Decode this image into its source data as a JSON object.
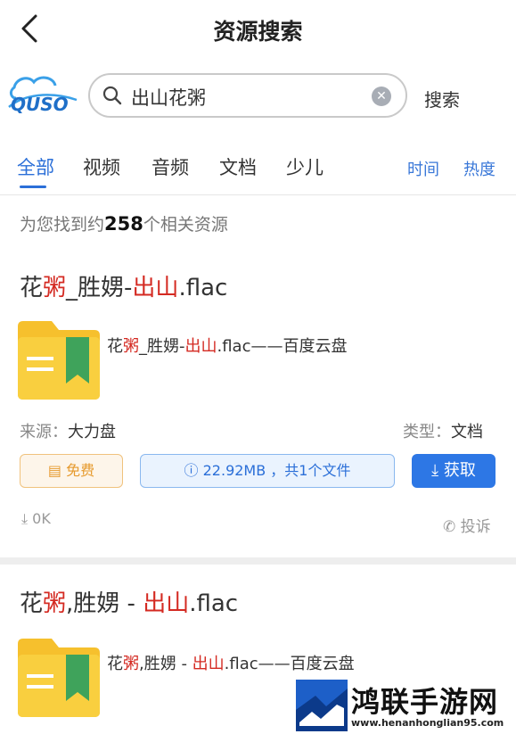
{
  "header": {
    "title": "资源搜索"
  },
  "search": {
    "value": "出山花粥",
    "button": "搜索"
  },
  "logo": {
    "text": "QUSO"
  },
  "tabs": [
    {
      "label": "全部",
      "active": true
    },
    {
      "label": "视频"
    },
    {
      "label": "音频"
    },
    {
      "label": "文档"
    },
    {
      "label": "少儿"
    }
  ],
  "sort": {
    "time": "时间",
    "hot": "热度"
  },
  "result_count": {
    "prefix": "为您找到约",
    "number": "258",
    "suffix": "个相关资源"
  },
  "results": [
    {
      "title_parts": [
        "花",
        "粥",
        "_胜娚-",
        "出山",
        ".flac"
      ],
      "desc_parts": [
        "花",
        "粥",
        "_胜娚-",
        "出山",
        ".flac——百度云盘"
      ],
      "source_label": "来源：",
      "source": "大力盘",
      "type_label": "类型：",
      "type": "文档",
      "free": "免费",
      "size": "22.92MB ，共1个文件",
      "get": "获取",
      "downloads": "0K",
      "report": "投诉"
    },
    {
      "title_parts": [
        "花",
        "粥",
        ",胜娚 - ",
        "出山",
        ".flac"
      ],
      "desc_parts": [
        "花",
        "粥",
        ",胜娚 - ",
        "出山",
        ".flac——百度云盘"
      ]
    }
  ],
  "watermark": {
    "text": "鸿联手游网",
    "url": "www.henanhonglian95.com"
  },
  "colors": {
    "accent": "#2d77e5",
    "highlight": "#d42a22",
    "free": "#e69a2e"
  }
}
